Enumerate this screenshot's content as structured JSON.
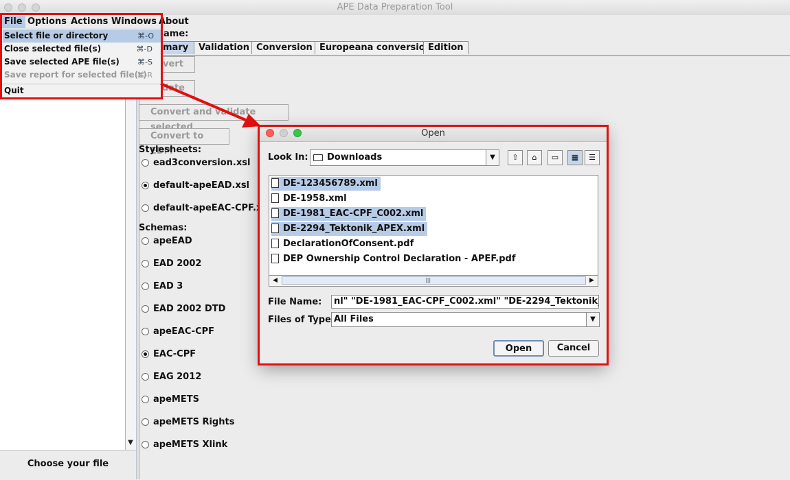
{
  "window": {
    "title": "APE Data Preparation Tool"
  },
  "menubar": [
    "File",
    "Options",
    "Actions",
    "Windows",
    "About"
  ],
  "file_menu": {
    "items": [
      {
        "label": "Select file or directory",
        "shortcut": "⌘-O"
      },
      {
        "label": "Close selected file(s)",
        "shortcut": "⌘-D"
      },
      {
        "label": "Save selected APE file(s)",
        "shortcut": "⌘-S"
      },
      {
        "label": "Save report for selected file(s)",
        "shortcut": "⌘-R"
      },
      {
        "label": "Quit"
      }
    ],
    "highlight_color": "#b6cbe6",
    "annotation_color": "#e01010"
  },
  "main": {
    "name_label": "ame:",
    "tabs": [
      "mary",
      "Validation",
      "Conversion",
      "Europeana conversion",
      "Edition"
    ],
    "buttons": {
      "convert": "nvert",
      "validate": "idate",
      "convert_validate": "Convert and validate selected",
      "convert_edm": "Convert to EDM"
    },
    "stylesheets_label": "Stylesheets:",
    "stylesheets": [
      {
        "label": "ead3conversion.xsl",
        "selected": false
      },
      {
        "label": "default-apeEAD.xsl",
        "selected": true
      },
      {
        "label": "default-apeEAC-CPF.xsl",
        "selected": false
      }
    ],
    "schemas_label": "Schemas:",
    "schemas": [
      {
        "label": "apeEAD",
        "selected": false
      },
      {
        "label": "EAD 2002",
        "selected": false
      },
      {
        "label": "EAD 3",
        "selected": false
      },
      {
        "label": "EAD 2002 DTD",
        "selected": false
      },
      {
        "label": "apeEAC-CPF",
        "selected": false
      },
      {
        "label": "EAC-CPF",
        "selected": true
      },
      {
        "label": "EAG 2012",
        "selected": false
      },
      {
        "label": "apeMETS",
        "selected": false
      },
      {
        "label": "apeMETS Rights",
        "selected": false
      },
      {
        "label": "apeMETS Xlink",
        "selected": false
      }
    ]
  },
  "left_pane": {
    "choose_button": "Choose your file"
  },
  "dialog": {
    "title": "Open",
    "look_in_label": "Look In:",
    "look_in_value": "Downloads",
    "files": [
      {
        "name": "DE-123456789.xml",
        "selected": true
      },
      {
        "name": "DE-1958.xml",
        "selected": false
      },
      {
        "name": "DE-1981_EAC-CPF_C002.xml",
        "selected": true
      },
      {
        "name": "DE-2294_Tektonik_APEX.xml",
        "selected": true
      },
      {
        "name": "DeclarationOfConsent.pdf",
        "selected": false
      },
      {
        "name": "DEP Ownership Control Declaration - APEF.pdf",
        "selected": false
      }
    ],
    "file_name_label": "File Name:",
    "file_name_value": "nl\" \"DE-1981_EAC-CPF_C002.xml\" \"DE-2294_Tektonik_APEX.xml\"",
    "files_of_type_label": "Files of Type:",
    "files_of_type_value": "All Files",
    "open_button": "Open",
    "cancel_button": "Cancel"
  }
}
